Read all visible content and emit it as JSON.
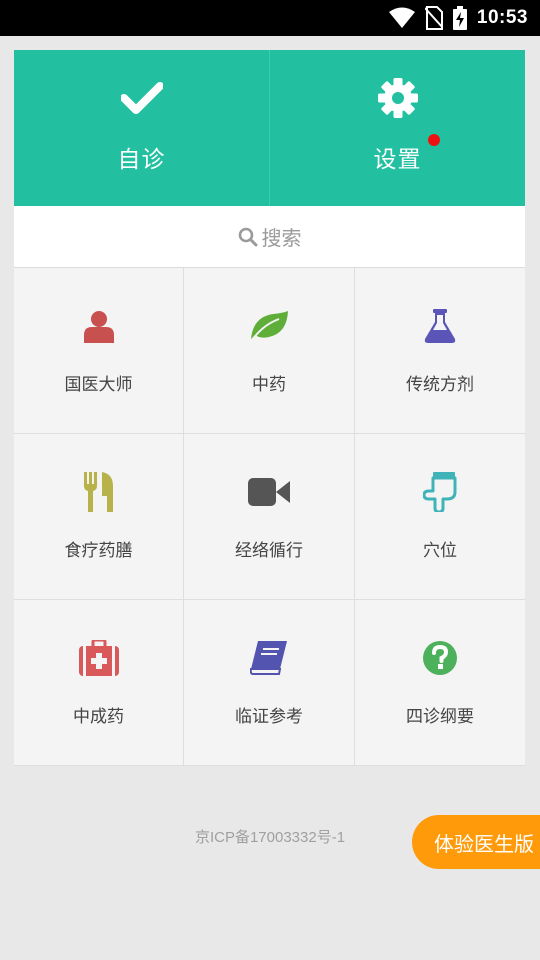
{
  "status_bar": {
    "time": "10:53"
  },
  "header": {
    "self_diagnosis_label": "自诊",
    "settings_label": "设置"
  },
  "search": {
    "label": "搜索"
  },
  "grid": {
    "items": [
      {
        "label": "国医大师",
        "icon": "person-icon",
        "color": "#c8504e"
      },
      {
        "label": "中药",
        "icon": "leaf-icon",
        "color": "#5fae3a"
      },
      {
        "label": "传统方剂",
        "icon": "flask-icon",
        "color": "#5c55b8"
      },
      {
        "label": "食疗药膳",
        "icon": "utensils-icon",
        "color": "#b8b24a"
      },
      {
        "label": "经络循行",
        "icon": "video-camera-icon",
        "color": "#555555"
      },
      {
        "label": "穴位",
        "icon": "hand-pointer-icon",
        "color": "#3fb3b8"
      },
      {
        "label": "中成药",
        "icon": "medkit-icon",
        "color": "#d9585a"
      },
      {
        "label": "临证参考",
        "icon": "book-icon",
        "color": "#5254b0"
      },
      {
        "label": "四诊纲要",
        "icon": "question-circle-icon",
        "color": "#4cb15a"
      }
    ]
  },
  "footer": {
    "icp": "京ICP备17003332号-1"
  },
  "fab": {
    "label": "体验医生版"
  },
  "colors": {
    "header": "#22c0a0",
    "fab": "#ff9a0a",
    "badge": "#ee1111"
  }
}
